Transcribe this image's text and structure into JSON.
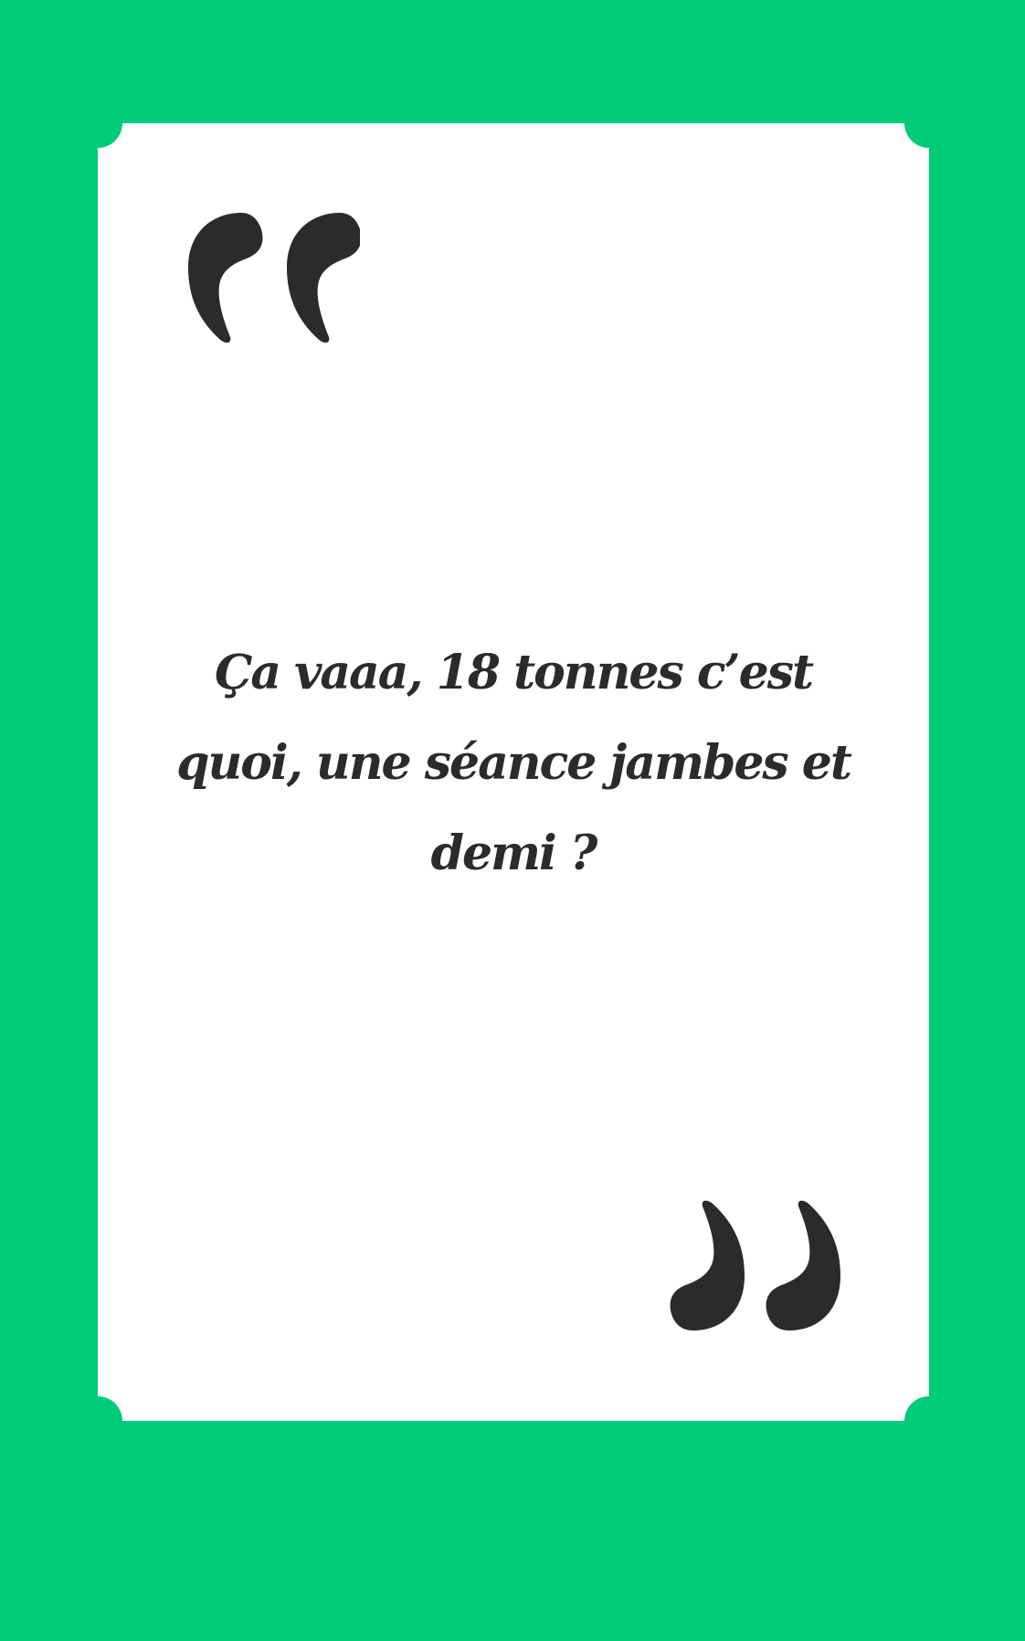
{
  "colors": {
    "background": "#00cc78",
    "card": "#ffffff",
    "ink": "#2b2b2b"
  },
  "quote": {
    "text": "Ça vaaa, 18 tonnes c’est quoi, une séance jambes et demi ?"
  },
  "icons": {
    "open_quote": "opening-quotation-mark-icon",
    "close_quote": "closing-quotation-mark-icon"
  }
}
